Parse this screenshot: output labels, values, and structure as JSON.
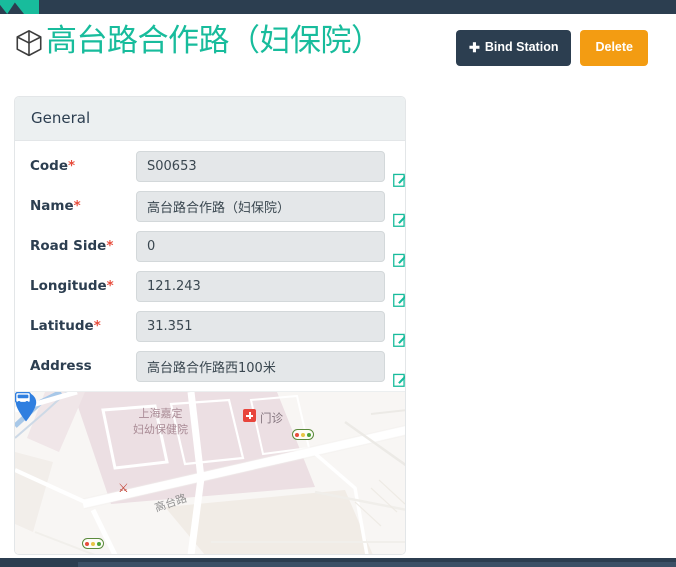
{
  "theme": {
    "accent_teal": "#18bc9c",
    "navy": "#2c3e50",
    "orange": "#f39c12",
    "required_red": "#e74c3c",
    "field_bg": "#e4e7e9",
    "panel_head_bg": "#ecf0f1"
  },
  "navbar": {
    "brand_icon": "brand-logo-icon"
  },
  "header": {
    "icon": "cube-icon",
    "title": "高台路合作路（妇保院）",
    "actions": {
      "bind_station_label": "Bind Station",
      "bind_station_icon": "plus-icon",
      "delete_label": "Delete"
    }
  },
  "panel": {
    "title": "General",
    "fields": [
      {
        "label": "Code",
        "required": true,
        "value": "S00653",
        "placeholder": "",
        "edit_icon": "edit-pencil-icon"
      },
      {
        "label": "Name",
        "required": true,
        "value": "高台路合作路（妇保院）",
        "placeholder": "",
        "edit_icon": "edit-pencil-icon"
      },
      {
        "label": "Road Side",
        "required": true,
        "value": "0",
        "placeholder": "",
        "edit_icon": "edit-pencil-icon"
      },
      {
        "label": "Longitude",
        "required": true,
        "value": "121.243",
        "placeholder": "",
        "edit_icon": "edit-pencil-icon"
      },
      {
        "label": "Latitude",
        "required": true,
        "value": "31.351",
        "placeholder": "",
        "edit_icon": "edit-pencil-icon"
      },
      {
        "label": "Address",
        "required": false,
        "value": "高台路合作路西100米",
        "placeholder": "",
        "edit_icon": "edit-pencil-icon"
      }
    ]
  },
  "map": {
    "labels": {
      "hospital_line1": "上海嘉定",
      "hospital_line2": "妇幼保健院",
      "clinic": "门诊",
      "road": "高台路"
    },
    "markers": {
      "station_pin": "location-pin-icon",
      "bus_stop": "bus-icon",
      "hospital_poi": "hospital-cross-icon",
      "temple_poi": "temple-icon",
      "traffic_light_1": "traffic-light-icon",
      "traffic_light_2": "traffic-light-icon"
    }
  }
}
